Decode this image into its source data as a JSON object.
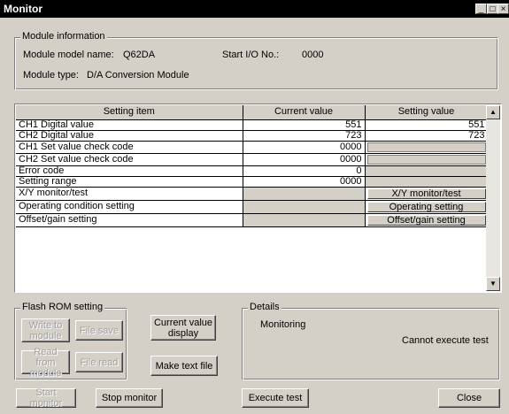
{
  "window": {
    "title": "Monitor",
    "controls": [
      "_",
      "□",
      "×"
    ]
  },
  "module_info": {
    "legend": "Module information",
    "model_label": "Module model name:",
    "model_value": "Q62DA",
    "start_io_label": "Start I/O No.:",
    "start_io_value": "0000",
    "type_label": "Module type:",
    "type_value": "D/A Conversion Module"
  },
  "table": {
    "headers": [
      "Setting item",
      "Current value",
      "Setting value"
    ],
    "rows": [
      {
        "item": "CH1 Digital value",
        "current": "551",
        "setting": "551"
      },
      {
        "item": "CH2 Digital value",
        "current": "723",
        "setting": "723"
      },
      {
        "item": "CH1 Set value check code",
        "current": "0000",
        "setting": ""
      },
      {
        "item": "CH2 Set value check code",
        "current": "0000",
        "setting": ""
      },
      {
        "item": "Error code",
        "current": "0",
        "setting": ""
      },
      {
        "item": "Setting range",
        "current": "0000",
        "setting": ""
      },
      {
        "item": "X/Y monitor/test",
        "current": "",
        "setting": "X/Y monitor/test"
      },
      {
        "item": "Operating condition setting",
        "current": "",
        "setting": "Operating setting"
      },
      {
        "item": "Offset/gain setting",
        "current": "",
        "setting": "Offset/gain setting"
      }
    ]
  },
  "flash_rom": {
    "legend": "Flash ROM setting",
    "write_to_module": "Write to module",
    "file_save": "File save",
    "read_from_module": "Read from module",
    "file_read": "File read"
  },
  "current_value_display": "Current value display",
  "make_text_file": "Make text file",
  "details": {
    "legend": "Details",
    "status": "Monitoring",
    "message": "Cannot execute test"
  },
  "bottom": {
    "start_monitor": "Start monitor",
    "stop_monitor": "Stop monitor",
    "execute_test": "Execute test",
    "close": "Close"
  }
}
